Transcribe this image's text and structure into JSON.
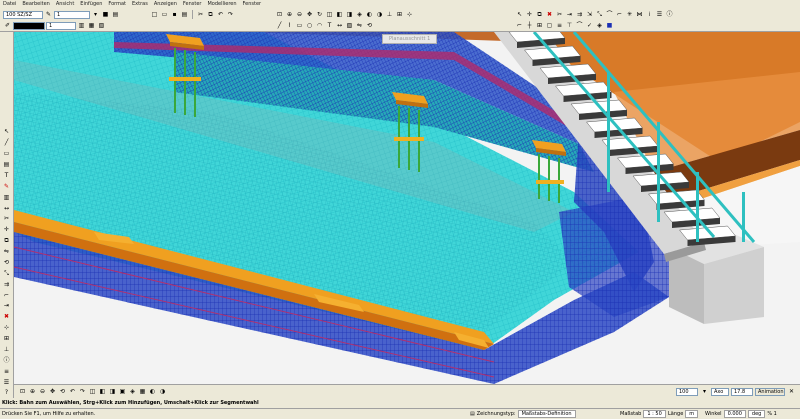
{
  "menu": [
    "Datei",
    "Bearbeiten",
    "Ansicht",
    "Einfügen",
    "Format",
    "Extras",
    "Anzeigen",
    "Fenster",
    "Modellieren",
    "Fenster"
  ],
  "toolbar": {
    "layer_combo": "100 SZ/SZ",
    "scale_combo": "1",
    "color_combo": "1"
  },
  "viewport": {
    "view_tab": "Planausschnitt 1"
  },
  "bottom_toolbar": {
    "zoom_value": "100",
    "angle_label": "Axo",
    "angle_value": "17.8",
    "view_button": "Animation"
  },
  "hint_text": "Klick: Bahn zum Auswählen, Strg+Klick zum Hinzufügen, Umschalt+Klick zur Segmentwahl",
  "status": {
    "left_text": "Drücken Sie F1, um Hilfe zu erhalten.",
    "drawing_type_label": "Zeichnungstyp:",
    "drawing_type_value": "Maßstabs-Definition",
    "scale_label": "Maßstab",
    "scale_value": "1 : 50",
    "length_label": "Länge",
    "length_value": "m",
    "angle_label": "Winkel",
    "angle_value": "0.000",
    "unit_value": "deg",
    "percent_value": "% 1"
  },
  "colors": {
    "mesh": "#3fd8d8",
    "rebar_blue": "#1a2fb4",
    "orange": "#f0a020",
    "slab_top": "#d06000",
    "slab_face": "#8a4a1a"
  }
}
